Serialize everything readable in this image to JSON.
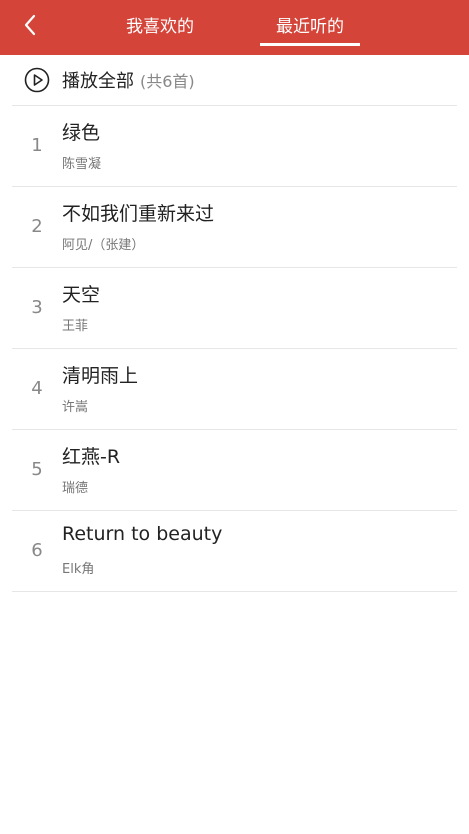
{
  "header": {
    "back_icon": "chevron-left-icon",
    "tabs": [
      {
        "label": "我喜欢的",
        "active": false
      },
      {
        "label": "最近听的",
        "active": true
      }
    ],
    "accent_color": "#d44439"
  },
  "play_all": {
    "icon": "play-circle-icon",
    "label": "播放全部",
    "count": "(共6首)"
  },
  "songs": [
    {
      "index": "1",
      "title": "绿色",
      "artist": "陈雪凝"
    },
    {
      "index": "2",
      "title": "不如我们重新来过",
      "artist": "阿见/（张建）"
    },
    {
      "index": "3",
      "title": "天空",
      "artist": "王菲"
    },
    {
      "index": "4",
      "title": "清明雨上",
      "artist": "许嵩"
    },
    {
      "index": "5",
      "title": "红燕-R",
      "artist": "瑞德"
    },
    {
      "index": "6",
      "title": "Return to beauty",
      "artist": "Elk角"
    }
  ]
}
